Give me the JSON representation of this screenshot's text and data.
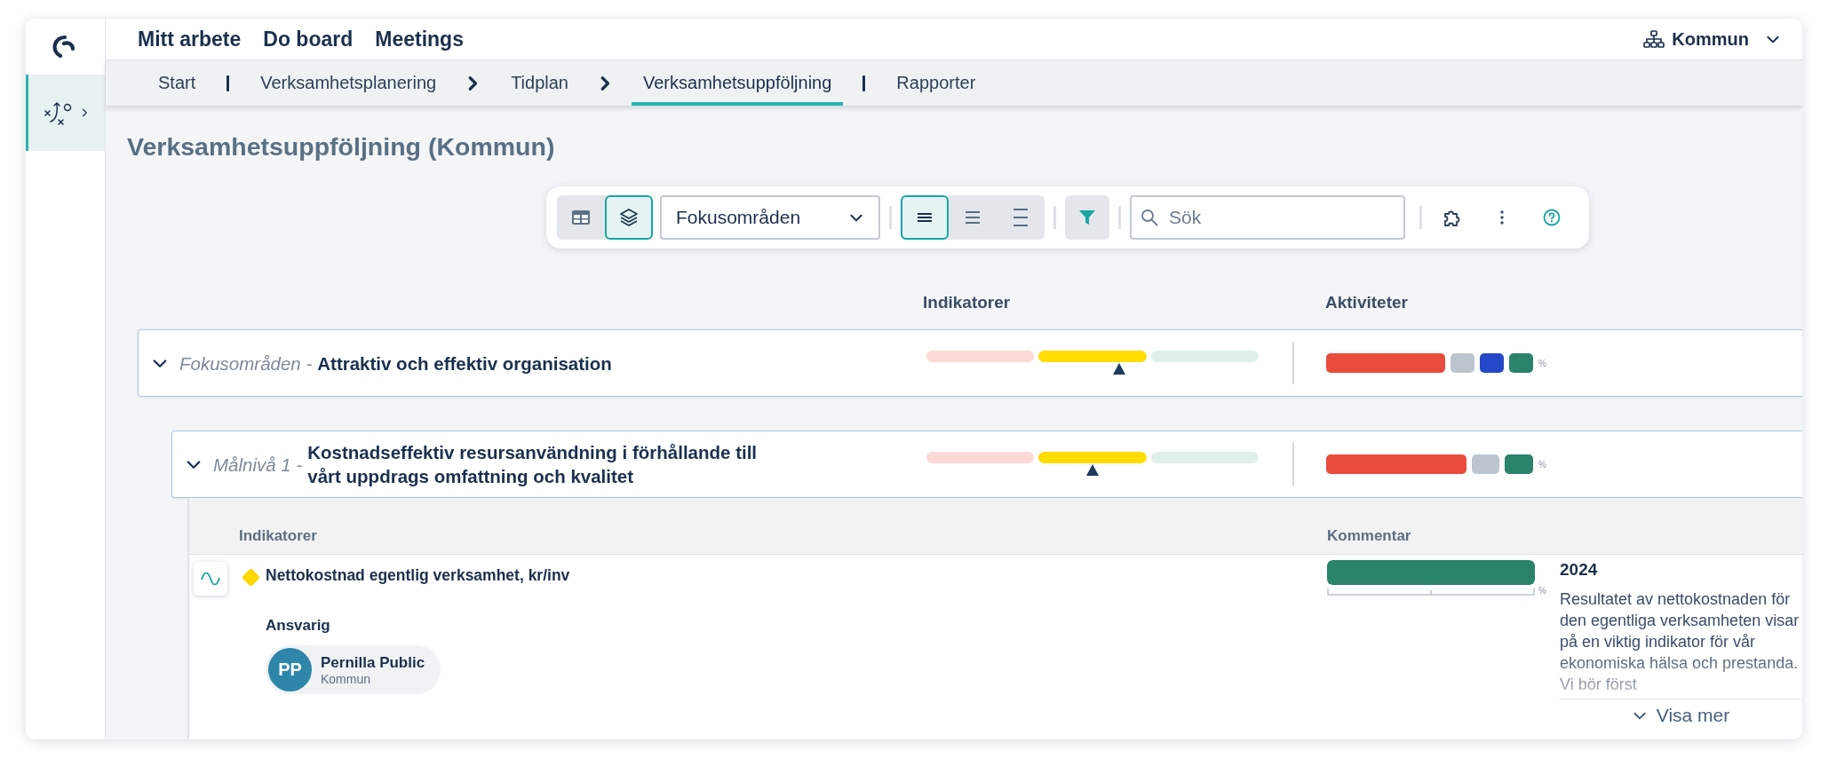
{
  "sidebar": {
    "items": [
      {
        "kind": "strategy",
        "selected": true
      }
    ]
  },
  "nav": [
    "Mitt arbete",
    "Do board",
    "Meetings"
  ],
  "org_switcher": {
    "label": "Kommun"
  },
  "breadcrumbs": [
    {
      "kind": "tab",
      "label": "Start",
      "selected": false
    },
    {
      "kind": "bar"
    },
    {
      "kind": "tab",
      "label": "Verksamhetsplanering",
      "selected": false
    },
    {
      "kind": "chevron"
    },
    {
      "kind": "tab",
      "label": "Tidplan",
      "selected": false
    },
    {
      "kind": "chevron"
    },
    {
      "kind": "tab",
      "label": "Verksamhetsuppföljning",
      "selected": true
    },
    {
      "kind": "bar"
    },
    {
      "kind": "tab",
      "label": "Rapporter",
      "selected": false
    }
  ],
  "page_title": "Verksamhetsuppföljning (Kommun)",
  "toolbar": {
    "view_buttons": [
      {
        "kind": "table",
        "selected": false
      },
      {
        "kind": "layers",
        "selected": true
      }
    ],
    "grouping": {
      "value": "Fokusområden"
    },
    "density_buttons": [
      {
        "kind": "compact",
        "selected": true
      },
      {
        "kind": "normal",
        "selected": false
      },
      {
        "kind": "wide",
        "selected": false
      }
    ],
    "filter": {
      "active": true
    },
    "search": {
      "placeholder": "Sök"
    },
    "actions": [
      {
        "kind": "puzzle"
      },
      {
        "kind": "more"
      },
      {
        "kind": "help"
      }
    ]
  },
  "columns": [
    "Indikatorer",
    "Aktiviteter"
  ],
  "rows": [
    {
      "prefix": "Fokusområden -",
      "title": "Attraktiv och effektiv organisation",
      "expanded": true,
      "indicators": {
        "zones": [
          {
            "color": "#fcd9d6"
          },
          {
            "color": "#ffdd00"
          },
          {
            "color": "#dff0ea"
          }
        ],
        "level": 0.58
      },
      "activities": {
        "segments": [
          {
            "color": "#e84c3d"
          },
          {
            "color": "#bcc5ce"
          },
          {
            "color": "#2548c9"
          },
          {
            "color": "#2a836a"
          }
        ],
        "unit": "%"
      },
      "children": [
        {
          "prefix": "Målnivå 1 -",
          "title": "Kostnadseffektiv resursanvändning i förhållande till vårt uppdrags omfattning och kvalitet",
          "expanded": true,
          "indicators": {
            "zones": [
              {
                "color": "#fcd9d6"
              },
              {
                "color": "#ffdd00"
              },
              {
                "color": "#dff0ea"
              }
            ],
            "level": 0.5
          },
          "activities": {
            "segments": [
              {
                "color": "#e84c3d"
              },
              {
                "color": "#bcc5ce"
              },
              {
                "color": "#2a836a"
              }
            ],
            "unit": "%"
          },
          "details": {
            "columns": [
              "Indikatorer",
              "Kommentar"
            ],
            "indicators": [
              {
                "name": "Nettokostnad egentlig verksamhet, kr/inv",
                "color": "#ffd600",
                "responsible_label": "Ansvarig",
                "person": {
                  "initials": "PP",
                  "name": "Pernilla Public",
                  "unit": "Kommun"
                },
                "result": {
                  "level": 1,
                  "unit": "%"
                },
                "comment": {
                  "year": "2024",
                  "text": "Resultatet av nettokostnaden för den egentliga verksamheten visar på en viktig indikator för vår ekonomiska hälsa och prestanda. Vi bör först",
                  "more": "Visa mer"
                }
              }
            ]
          }
        }
      ]
    }
  ]
}
